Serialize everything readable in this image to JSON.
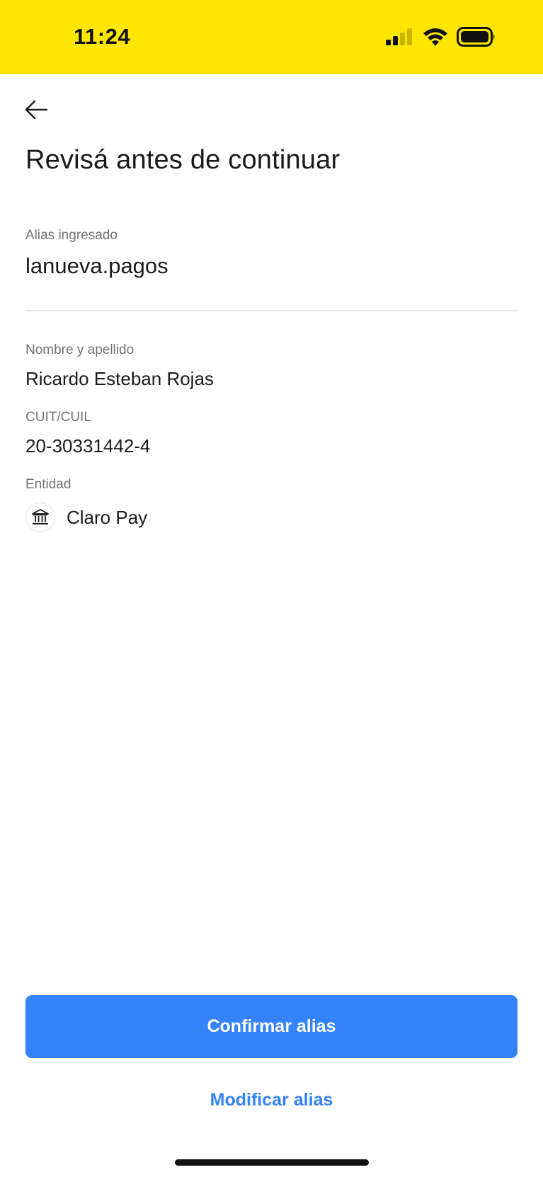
{
  "status_bar": {
    "time": "11:24",
    "background_color": "#ffe600",
    "icons": [
      "signal-icon",
      "wifi-icon",
      "battery-icon"
    ]
  },
  "header": {
    "back_icon": "arrow-left-icon",
    "title": "Revisá antes de continuar"
  },
  "alias": {
    "label": "Alias ingresado",
    "value": "lanueva.pagos"
  },
  "details": {
    "name": {
      "label": "Nombre y apellido",
      "value": "Ricardo Esteban Rojas"
    },
    "cuit": {
      "label": "CUIT/CUIL",
      "value": "20-30331442-4"
    },
    "entity": {
      "label": "Entidad",
      "value": "Claro Pay",
      "icon": "bank-icon"
    }
  },
  "actions": {
    "confirm_label": "Confirmar alias",
    "modify_label": "Modificar alias",
    "accent_color": "#3483fa"
  }
}
